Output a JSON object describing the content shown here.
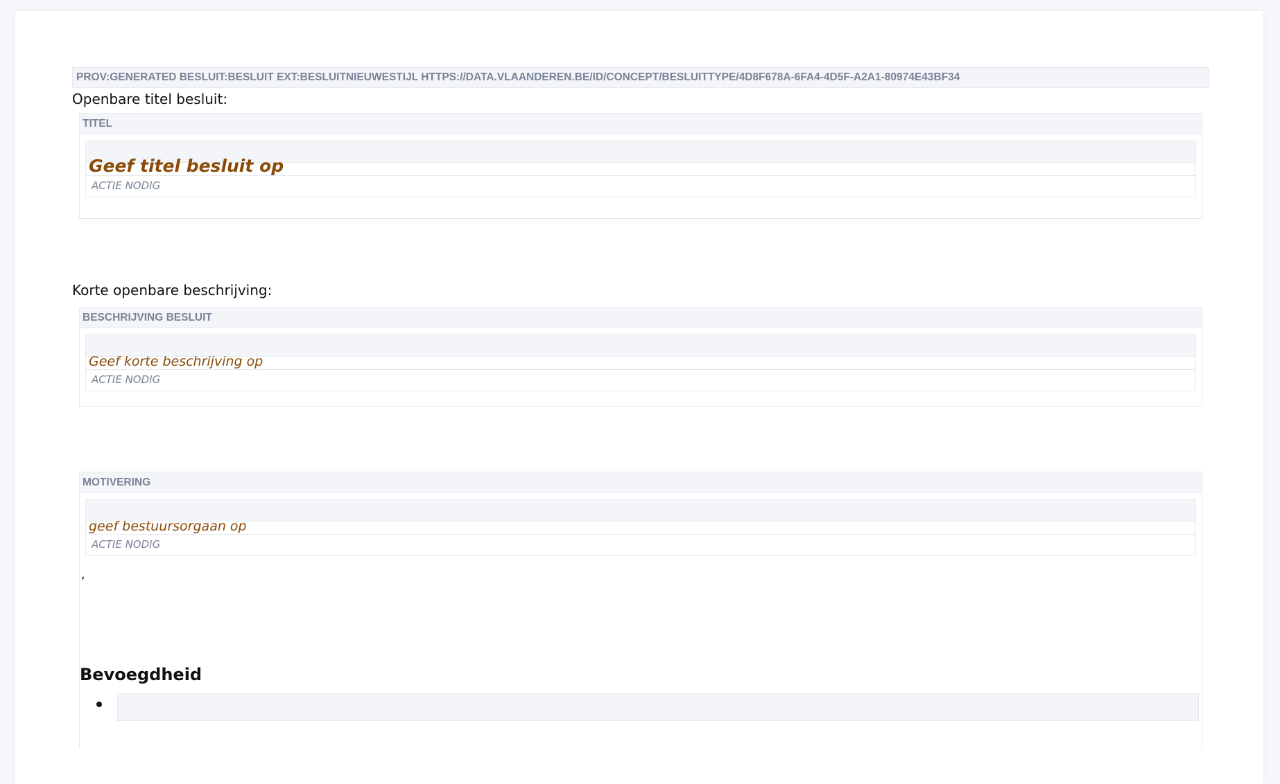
{
  "rdfa_bar": {
    "label": "PROV:GENERATED BESLUIT:BESLUIT EXT:BESLUITNIEUWESTIJL HTTPS://DATA.VLAANDEREN.BE/ID/CONCEPT/BESLUITTYPE/4D8F678A-6FA4-4D5F-A2A1-80974E43BF34"
  },
  "sections": {
    "title_label": "Openbare titel besluit:",
    "description_label": "Korte openbare beschrijving:"
  },
  "panels": {
    "titel": {
      "header": "TITEL",
      "placeholder": "Geef titel besluit op",
      "status": "ACTIE NODIG"
    },
    "beschrijving": {
      "header": "BESCHRIJVING BESLUIT",
      "placeholder": "Geef korte beschrijving op",
      "status": "ACTIE NODIG"
    },
    "motivering": {
      "header": "MOTIVERING",
      "placeholder": "geef bestuursorgaan op",
      "status": "ACTIE NODIG",
      "trailing_text": ","
    }
  },
  "bevoegdheid": {
    "heading": "Bevoegdheid"
  },
  "colors": {
    "placeholder_text": "#8a4b08",
    "header_text": "#7a8496",
    "header_background": "#f3f5f9",
    "border": "#e6e9ef"
  }
}
